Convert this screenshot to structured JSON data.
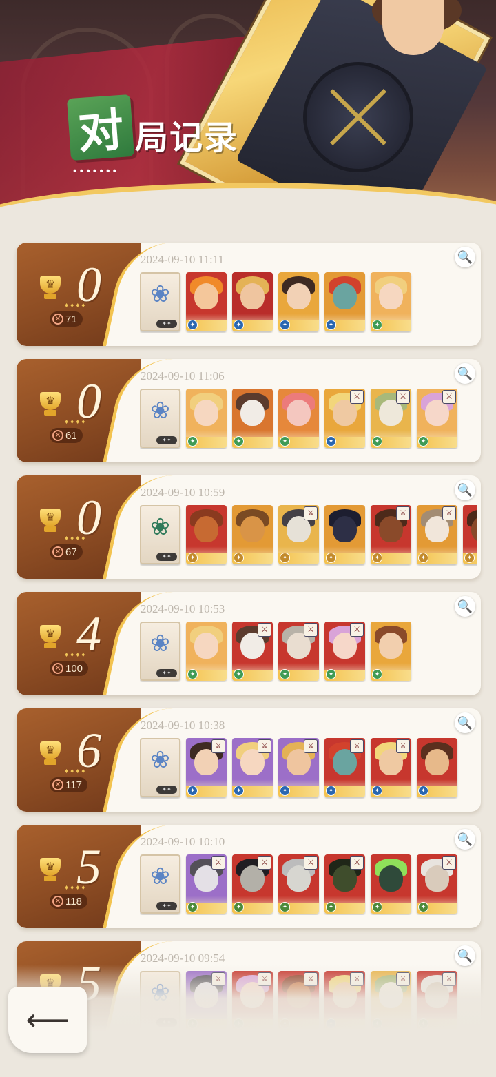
{
  "header": {
    "title_highlight": "对",
    "title_rest": "局记录",
    "dots": "•••••••"
  },
  "records": [
    {
      "score": "0",
      "kills": "71",
      "timestamp": "2024-09-10 11:11",
      "artifact": {
        "icon": "sack-icon",
        "bg": "#f3e6cf"
      },
      "units": [
        {
          "bg": "#c7372e",
          "skin": "#f4c79b",
          "hair": "#f08a2a",
          "faction": "#2a67b1",
          "item": false
        },
        {
          "bg": "#b92d2a",
          "skin": "#efc59f",
          "hair": "#e4b256",
          "faction": "#2a67b1",
          "item": false
        },
        {
          "bg": "#e9a73c",
          "skin": "#f2d1b5",
          "hair": "#3e2a22",
          "faction": "#2a67b1",
          "item": false
        },
        {
          "bg": "#e39a35",
          "skin": "#6aa4a0",
          "hair": "#d2422d",
          "faction": "#2a67b1",
          "item": false
        },
        {
          "bg": "#f0b25c",
          "skin": "#f6d7c0",
          "hair": "#f1cf7e",
          "faction": "#3f9b55",
          "item": false
        }
      ]
    },
    {
      "score": "0",
      "kills": "61",
      "timestamp": "2024-09-10 11:06",
      "artifact": {
        "icon": "blue-flower-icon",
        "bg": "#e9eff5"
      },
      "units": [
        {
          "bg": "#f0b25c",
          "skin": "#f6d7c0",
          "hair": "#f1cf7e",
          "faction": "#3f9b55",
          "item": false
        },
        {
          "bg": "#d9762f",
          "skin": "#f1ece6",
          "hair": "#5b3b2d",
          "faction": "#3f9b55",
          "item": false
        },
        {
          "bg": "#e6883b",
          "skin": "#f4c7bf",
          "hair": "#ec7b7b",
          "faction": "#3f9b55",
          "item": false
        },
        {
          "bg": "#e9a73c",
          "skin": "#efc9a2",
          "hair": "#f2d67b",
          "faction": "#2a67b1",
          "item": true
        },
        {
          "bg": "#e9b54c",
          "skin": "#eee8da",
          "hair": "#a8b97a",
          "faction": "#3f9b55",
          "item": true
        },
        {
          "bg": "#f0b25c",
          "skin": "#f6d7c9",
          "hair": "#d9a3d8",
          "faction": "#3f9b55",
          "item": true
        }
      ]
    },
    {
      "score": "0",
      "kills": "67",
      "timestamp": "2024-09-10 10:59",
      "artifact": {
        "icon": "green-lantern-icon",
        "bg": "#e8eee0"
      },
      "units": [
        {
          "bg": "#c7372e",
          "skin": "#c76a32",
          "hair": "#8a3a1f",
          "faction": "#c38b2c",
          "item": false
        },
        {
          "bg": "#e39a35",
          "skin": "#d99447",
          "hair": "#7a4a23",
          "faction": "#c38b2c",
          "item": false
        },
        {
          "bg": "#e9b54c",
          "skin": "#e6e1d7",
          "hair": "#444046",
          "faction": "#c38b2c",
          "item": true
        },
        {
          "bg": "#e39a35",
          "skin": "#2d2f46",
          "hair": "#1d1e30",
          "faction": "#c38b2c",
          "item": false
        },
        {
          "bg": "#c7372e",
          "skin": "#8a4a2a",
          "hair": "#4d2a1a",
          "faction": "#c38b2c",
          "item": true
        },
        {
          "bg": "#e39a35",
          "skin": "#f1e6da",
          "hair": "#a38c73",
          "faction": "#c38b2c",
          "item": true
        },
        {
          "bg": "#c7372e",
          "skin": "#8a4a2a",
          "hair": "#4d2a1a",
          "faction": "#c38b2c",
          "item": false
        }
      ]
    },
    {
      "score": "4",
      "kills": "100",
      "timestamp": "2024-09-10 10:53",
      "artifact": {
        "icon": "blue-flower-icon",
        "bg": "#e9eff5"
      },
      "units": [
        {
          "bg": "#f0b25c",
          "skin": "#f6d7c0",
          "hair": "#f1cf7e",
          "faction": "#3f9b55",
          "item": false
        },
        {
          "bg": "#c7372e",
          "skin": "#f1ece6",
          "hair": "#5b3b2d",
          "faction": "#3f9b55",
          "item": true
        },
        {
          "bg": "#c7372e",
          "skin": "#e9ddd0",
          "hair": "#b8b2a8",
          "faction": "#3f9b55",
          "item": true
        },
        {
          "bg": "#c7372e",
          "skin": "#f6d7c9",
          "hair": "#d9a3d8",
          "faction": "#3f9b55",
          "item": true
        },
        {
          "bg": "#e9a73c",
          "skin": "#f2cfae",
          "hair": "#8a4a2a",
          "faction": "#3f9b55",
          "item": false
        }
      ]
    },
    {
      "score": "6",
      "kills": "117",
      "timestamp": "2024-09-10 10:38",
      "artifact": {
        "icon": "dark-vase-icon",
        "bg": "#f3ead9"
      },
      "units": [
        {
          "bg": "#9c6fc8",
          "skin": "#f2d1b5",
          "hair": "#3e2a22",
          "faction": "#2a67b1",
          "item": true
        },
        {
          "bg": "#9c6fc8",
          "skin": "#f6d7c0",
          "hair": "#f1cf7e",
          "faction": "#2a67b1",
          "item": true
        },
        {
          "bg": "#9c6fc8",
          "skin": "#efc59f",
          "hair": "#e4b256",
          "faction": "#2a67b1",
          "item": true
        },
        {
          "bg": "#c7372e",
          "skin": "#6aa4a0",
          "hair": "#d2422d",
          "faction": "#2a67b1",
          "item": true
        },
        {
          "bg": "#c7372e",
          "skin": "#efc9a2",
          "hair": "#f2d67b",
          "faction": "#2a67b1",
          "item": true
        },
        {
          "bg": "#c7372e",
          "skin": "#e7b98a",
          "hair": "#5a2f1e",
          "faction": "#2a67b1",
          "item": false
        }
      ]
    },
    {
      "score": "5",
      "kills": "118",
      "timestamp": "2024-09-10 10:10",
      "artifact": {
        "icon": "white-flower-icon",
        "bg": "#eef2f6"
      },
      "units": [
        {
          "bg": "#9c6fc8",
          "skin": "#e4e0e6",
          "hair": "#545058",
          "faction": "#4c8a3a",
          "item": true
        },
        {
          "bg": "#c7372e",
          "skin": "#b3b0a8",
          "hair": "#1f1d22",
          "faction": "#4c8a3a",
          "item": true
        },
        {
          "bg": "#c7372e",
          "skin": "#d7d6d0",
          "hair": "#bcbcbc",
          "faction": "#4c8a3a",
          "item": true
        },
        {
          "bg": "#c7372e",
          "skin": "#3f4d2c",
          "hair": "#1f2618",
          "faction": "#4c8a3a",
          "item": true
        },
        {
          "bg": "#c7372e",
          "skin": "#2f4a3a",
          "hair": "#8fe05a",
          "faction": "#4c8a3a",
          "item": false
        },
        {
          "bg": "#c7372e",
          "skin": "#d9cbbb",
          "hair": "#e8e4de",
          "faction": "#4c8a3a",
          "item": true
        }
      ]
    },
    {
      "score": "5",
      "kills": "",
      "timestamp": "2024-09-10 09:54",
      "artifact": {
        "icon": "partial-icon",
        "bg": "#efe3d2"
      },
      "units": [
        {
          "bg": "#9c6fc8",
          "skin": "#e4e0e6",
          "hair": "#545058",
          "faction": "#4c8a3a",
          "item": true
        },
        {
          "bg": "#c7372e",
          "skin": "#f6d7c9",
          "hair": "#d9a3d8",
          "faction": "#3f9b55",
          "item": true
        },
        {
          "bg": "#c7372e",
          "skin": "#c76a32",
          "hair": "#8a3a1f",
          "faction": "#c38b2c",
          "item": true
        },
        {
          "bg": "#c7372e",
          "skin": "#efc9a2",
          "hair": "#f2d67b",
          "faction": "#2a67b1",
          "item": true
        },
        {
          "bg": "#e9b54c",
          "skin": "#eee8da",
          "hair": "#a8b97a",
          "faction": "#3f9b55",
          "item": true
        },
        {
          "bg": "#c7372e",
          "skin": "#d9cbbb",
          "hair": "#e8e4de",
          "faction": "#4c8a3a",
          "item": true
        }
      ]
    }
  ],
  "glyphs": {
    "magnify": "🔍",
    "trophy": "♛",
    "stars": "♦♦♦♦",
    "kill": "✕",
    "artifact_tag": "✦✦",
    "item": "⚔",
    "faction": "✦",
    "back_arrow": "⟵"
  }
}
